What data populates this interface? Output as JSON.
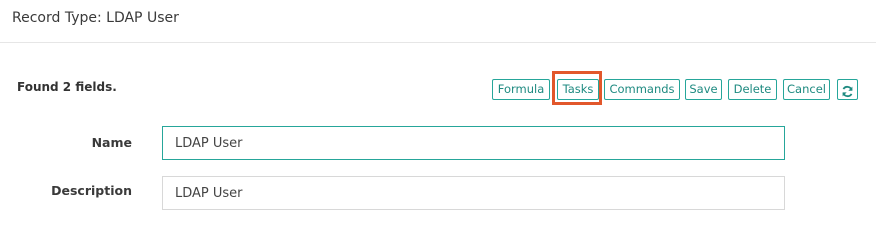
{
  "header": {
    "title": "Record Type: LDAP User"
  },
  "status": {
    "found_text": "Found 2 fields."
  },
  "toolbar": {
    "buttons": [
      {
        "label": "Formula"
      },
      {
        "label": "Tasks"
      },
      {
        "label": "Commands"
      },
      {
        "label": "Save"
      },
      {
        "label": "Delete"
      },
      {
        "label": "Cancel"
      }
    ],
    "refresh_icon": "refresh-icon",
    "accent_color": "#26a69a",
    "highlight_color": "#e2572b"
  },
  "form": {
    "name": {
      "label": "Name",
      "value": "LDAP User"
    },
    "description": {
      "label": "Description",
      "value": "LDAP User"
    }
  }
}
